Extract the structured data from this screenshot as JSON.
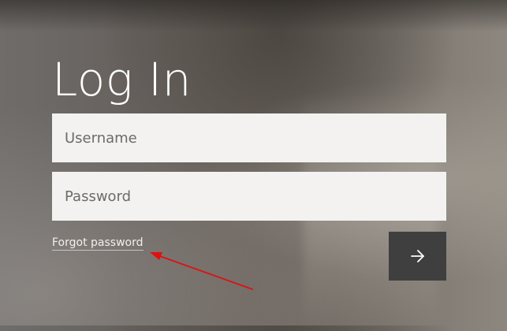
{
  "login": {
    "title": "Log In",
    "username_placeholder": "Username",
    "password_placeholder": "Password",
    "forgot_password_label": "Forgot password",
    "submit_icon": "arrow-right-icon"
  },
  "annotation": {
    "color": "#e01010"
  }
}
